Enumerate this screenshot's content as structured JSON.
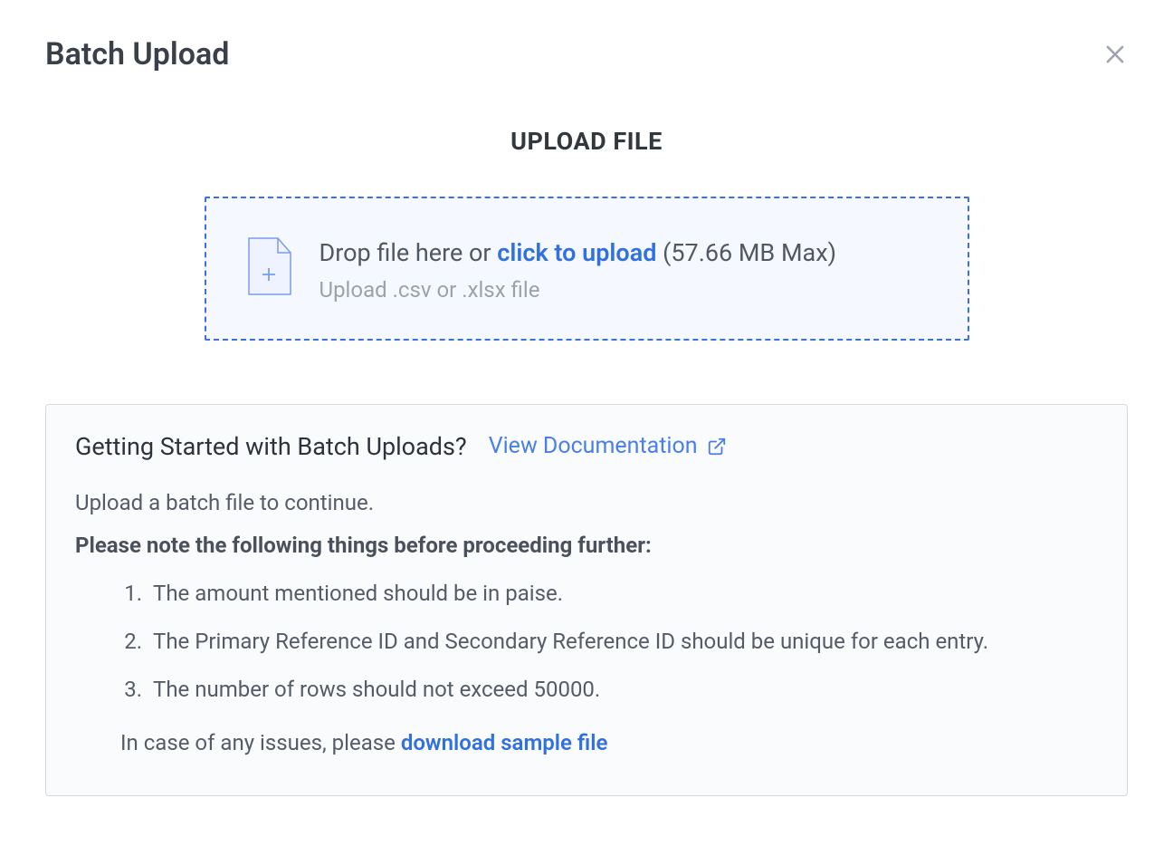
{
  "header": {
    "title": "Batch Upload"
  },
  "upload": {
    "heading": "UPLOAD FILE",
    "drop_prefix": "Drop file here or ",
    "drop_link": "click to upload",
    "drop_suffix": " (57.66 MB Max)",
    "hint": "Upload .csv or .xlsx file"
  },
  "info": {
    "title": "Getting Started with Batch Uploads?",
    "doc_link": "View Documentation",
    "intro": "Upload a batch file to continue.",
    "note": "Please note the following things before proceeding further:",
    "items": [
      "The amount mentioned should be in paise.",
      "The Primary Reference ID and Secondary Reference ID should be unique for each entry.",
      "The number of rows should not exceed 50000."
    ],
    "footer_prefix": "In case of any issues, please ",
    "footer_link": "download sample file"
  }
}
